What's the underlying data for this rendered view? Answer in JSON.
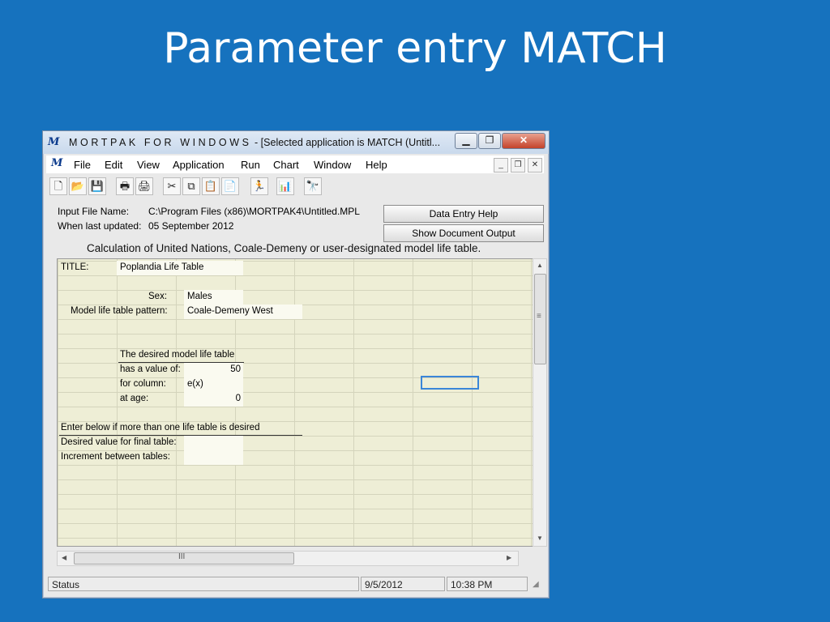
{
  "slide": {
    "title": "Parameter entry MATCH"
  },
  "window": {
    "icon_text": "M",
    "brand": "MORTPAK FOR WINDOWS",
    "title_suffix": " - [Selected application is MATCH  (Untitl...",
    "min_label": "▁",
    "max_label": "❐",
    "close_label": "✕"
  },
  "menu": {
    "icon_text": "M",
    "items": [
      "File",
      "Edit",
      "View",
      "Application",
      "Run",
      "Chart",
      "Window",
      "Help"
    ],
    "mdi_min": "_",
    "mdi_restore": "❐",
    "mdi_close": "✕"
  },
  "toolbar": {
    "icons": [
      "new-icon",
      "open-folder-icon",
      "save-icon",
      "print-icon",
      "print-preview-icon",
      "cut-icon",
      "copy-icon",
      "paste-icon",
      "clipboard-icon",
      "run-icon",
      "chart-icon",
      "find-icon"
    ]
  },
  "info": {
    "input_label": "Input File Name:",
    "input_value": "C:\\Program Files (x86)\\MORTPAK4\\Untitled.MPL",
    "updated_label": "When last updated:",
    "updated_value": "05 September 2012",
    "help_button": "Data Entry Help",
    "output_button": "Show Document Output",
    "calc_text": "Calculation of United Nations, Coale-Demeny or user-designated model life table."
  },
  "sheet": {
    "title_label": "TITLE:",
    "title_value": "Poplandia Life Table",
    "sex_label": "Sex:",
    "sex_value": "Males",
    "pattern_label": "Model life table pattern:",
    "pattern_value": "Coale-Demeny West",
    "desired_header": "The desired model life table",
    "value_label": "has a value of:",
    "value_value": "50",
    "column_label": "for column:",
    "column_value": "e(x)",
    "age_label": "at age:",
    "age_value": "0",
    "multi_header": "Enter below if more than one life table is desired",
    "final_label": "Desired value for final table:",
    "increment_label": "Increment between tables:",
    "hscroll_grip": "III",
    "vscroll_grip": "≡"
  },
  "status": {
    "label": "Status",
    "date": "9/5/2012",
    "time": "10:38 PM"
  }
}
